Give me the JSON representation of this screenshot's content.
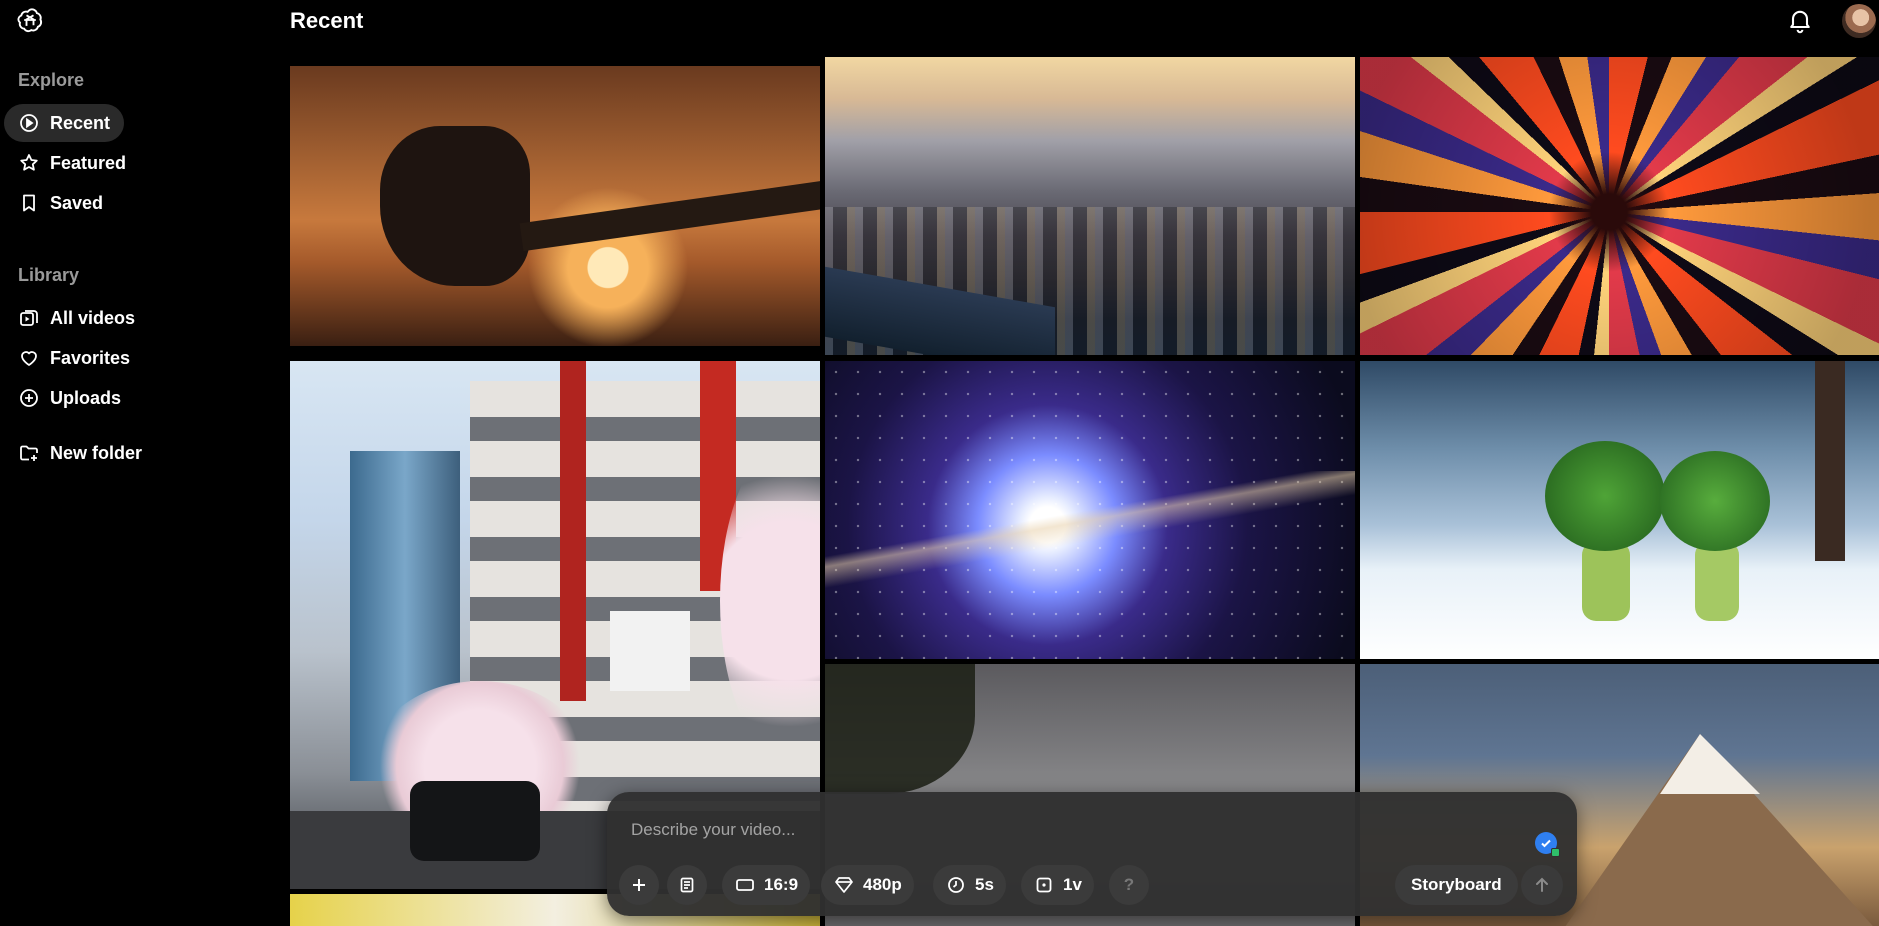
{
  "sidebar": {
    "explore_title": "Explore",
    "explore_items": [
      {
        "label": "Recent",
        "icon": "play-circle-icon",
        "active": true
      },
      {
        "label": "Featured",
        "icon": "star-icon"
      },
      {
        "label": "Saved",
        "icon": "bookmark-icon"
      }
    ],
    "library_title": "Library",
    "library_items": [
      {
        "label": "All videos",
        "icon": "videos-icon"
      },
      {
        "label": "Favorites",
        "icon": "heart-icon"
      },
      {
        "label": "Uploads",
        "icon": "plus-circle-icon"
      }
    ],
    "new_folder_label": "New folder"
  },
  "header": {
    "title": "Recent"
  },
  "composer": {
    "placeholder": "Describe your video...",
    "aspect_ratio": "16:9",
    "resolution": "480p",
    "duration": "5s",
    "variations": "1v",
    "help": "?",
    "storyboard_label": "Storyboard"
  },
  "colors": {
    "background": "#000000",
    "active_nav": "#2a2a2a",
    "composer_bg": "#303030",
    "accent": "#2f7ff0"
  }
}
